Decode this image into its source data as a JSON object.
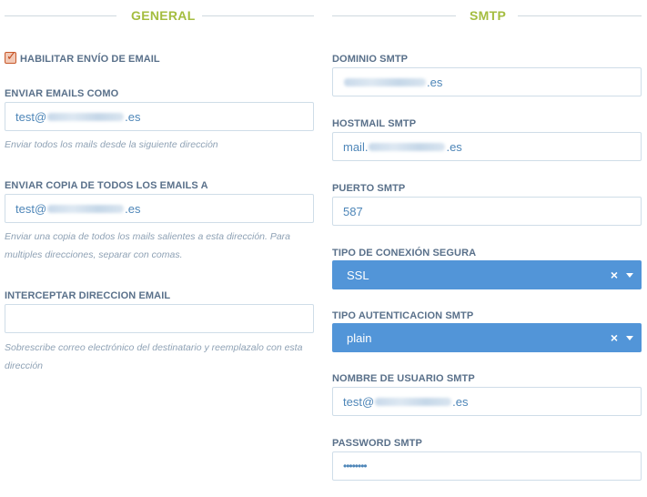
{
  "general": {
    "title": "GENERAL",
    "enable_email_label": "HABILITAR ENVÍO DE EMAIL",
    "send_as_label": "ENVIAR EMAILS COMO",
    "send_as_prefix": "test@",
    "send_as_suffix": ".es",
    "send_as_help": "Enviar todos los mails desde la siguiente dirección",
    "copy_label": "ENVIAR COPIA DE TODOS LOS EMAILS A",
    "copy_prefix": "test@",
    "copy_suffix": ".es",
    "copy_help": "Enviar una copia de todos los mails salientes a esta dirección. Para multiples direcciones, separar con comas.",
    "intercept_label": "INTERCEPTAR DIRECCION EMAIL",
    "intercept_value": "",
    "intercept_help": "Sobrescribe correo electrónico del destinatario y reemplazalo con esta dirección"
  },
  "smtp": {
    "title": "SMTP",
    "domain_label": "DOMINIO SMTP",
    "domain_suffix": ".es",
    "host_label": "HOSTMAIL SMTP",
    "host_prefix": "mail.",
    "host_suffix": ".es",
    "port_label": "PUERTO SMTP",
    "port_value": "587",
    "secure_label": "TIPO DE CONEXIÓN SEGURA",
    "secure_value": "SSL",
    "auth_label": "TIPO AUTENTICACION SMTP",
    "auth_value": "plain",
    "user_label": "NOMBRE DE USUARIO SMTP",
    "user_prefix": "test@",
    "user_suffix": ".es",
    "password_label": "PASSWORD SMTP",
    "password_value": "••••••••"
  },
  "icons": {
    "clear": "×"
  },
  "colors": {
    "section_title": "#a4bd3f",
    "select_bg": "#5295d8",
    "checkbox": "#c7592b"
  }
}
